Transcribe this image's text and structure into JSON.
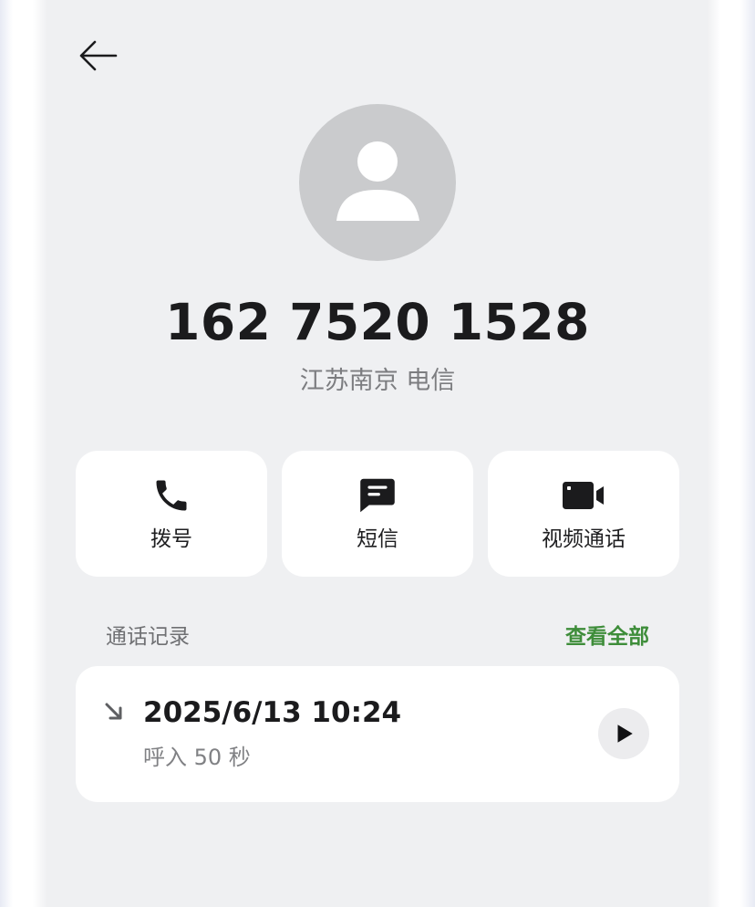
{
  "contact": {
    "phone_number": "162 7520 1528",
    "location": "江苏南京 电信"
  },
  "actions": [
    {
      "label": "拨号",
      "icon": "phone-icon"
    },
    {
      "label": "短信",
      "icon": "message-icon"
    },
    {
      "label": "视频通话",
      "icon": "video-camera-icon"
    }
  ],
  "call_history": {
    "title": "通话记录",
    "view_all": "查看全部",
    "records": [
      {
        "time": "2025/6/13 10:24",
        "detail": "呼入  50 秒",
        "direction_icon": "incoming-call-arrow-icon"
      }
    ]
  },
  "colors": {
    "background": "#eff0f2",
    "card": "#ffffff",
    "accent_green": "#3e8d3a",
    "avatar_gray": "#cacbcd"
  }
}
